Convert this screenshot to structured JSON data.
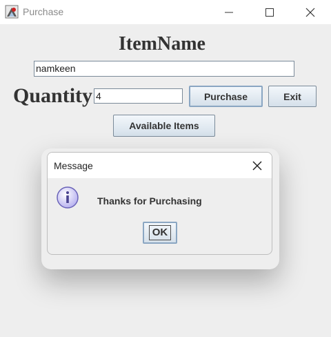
{
  "window": {
    "title": "Purchase"
  },
  "form": {
    "heading": "ItemName",
    "item_value": "namkeen",
    "quantity_label": "Quantity",
    "quantity_value": "4",
    "purchase_label": "Purchase",
    "exit_label": "Exit",
    "available_label": "Available Items"
  },
  "dialog": {
    "title": "Message",
    "message": "Thanks for Purchasing",
    "ok_label": "OK"
  },
  "icons": {
    "app": "app-icon",
    "minimize": "minimize-icon",
    "maximize": "maximize-icon",
    "close": "close-icon",
    "info": "info-icon"
  }
}
